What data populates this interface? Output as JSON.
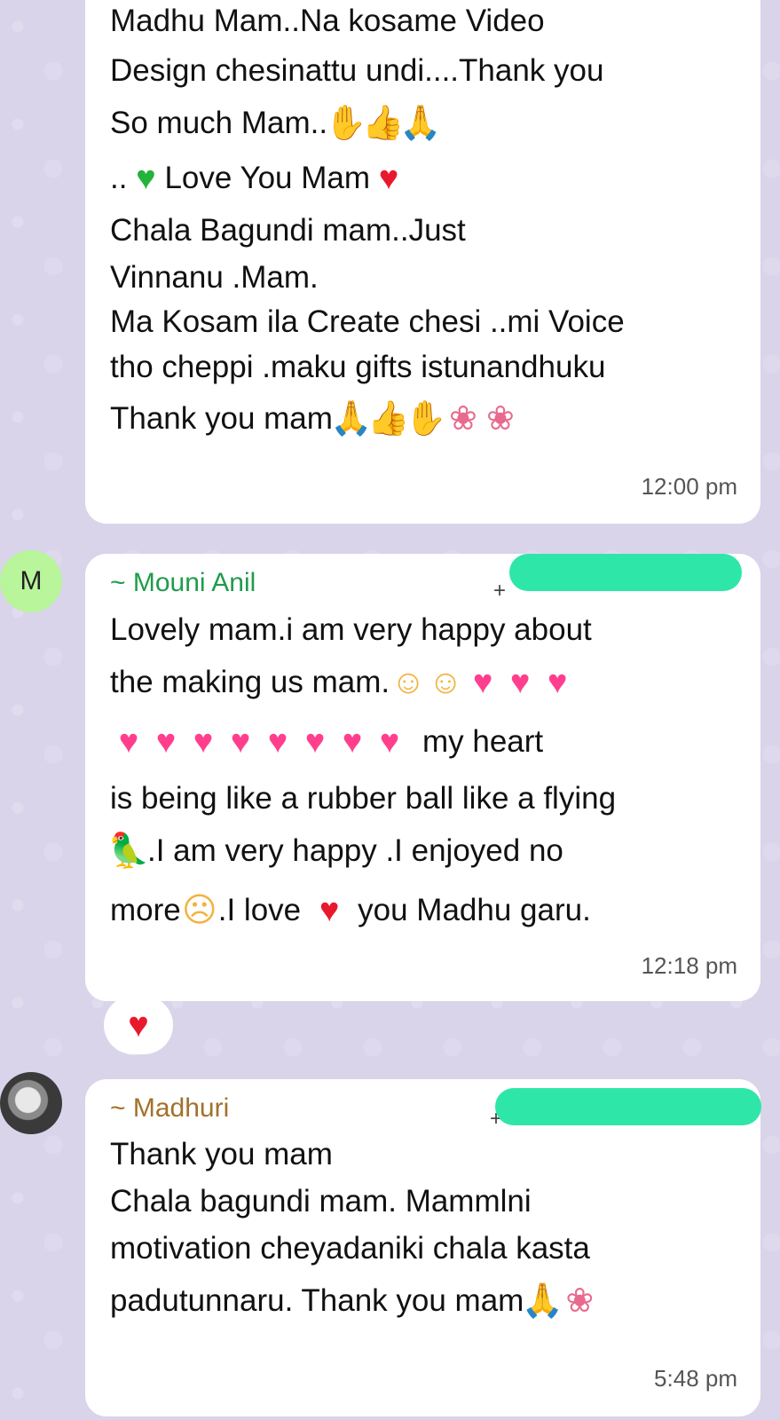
{
  "messages": [
    {
      "lines": [
        "Madhu Mam..Na kosame Video",
        "Design chesinattu undi....Thank you",
        "So much Mam..",
        "..",
        "Love You Mam",
        "Chala Bagundi mam..Just",
        "Vinnanu .Mam.",
        "Ma Kosam ila Create chesi ..mi Voice",
        "tho cheppi .maku gifts istunandhuku",
        "Thank you mam"
      ],
      "time": "12:00 pm"
    },
    {
      "avatar_letter": "M",
      "sender": "~ Mouni Anil",
      "phone_prefix": "+",
      "lines": [
        "Lovely mam.i am very happy about",
        "the making us mam.",
        "my heart",
        "is being like a rubber ball like a flying",
        ".I am very happy .I enjoyed no",
        "more",
        ".I love",
        "you Madhu garu."
      ],
      "time": "12:18 pm",
      "reaction": "heart-icon"
    },
    {
      "sender": "~ Madhuri",
      "phone_prefix": "+",
      "lines": [
        "Thank you mam",
        "Chala bagundi mam. Mammlni",
        "motivation cheyadaniki chala kasta",
        "padutunnaru. Thank you mam"
      ],
      "time": "5:48 pm"
    }
  ],
  "colors": {
    "background": "#d9d4ea",
    "bubble": "#ffffff",
    "sender_mouni": "#1f9c4b",
    "sender_madhuri": "#a3702a",
    "redaction": "#2ee6a8",
    "avatar_m": "#b8f59b"
  }
}
